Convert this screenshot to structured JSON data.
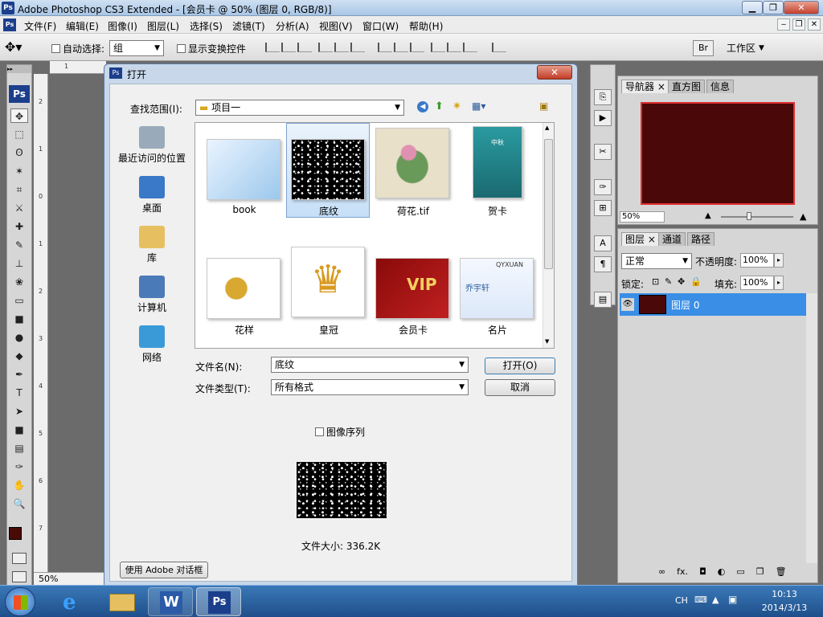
{
  "window": {
    "title": "Adobe Photoshop CS3 Extended - [会员卡 @ 50% (图层 0, RGB/8)]",
    "ps_label": "Ps"
  },
  "menu": [
    "文件(F)",
    "编辑(E)",
    "图像(I)",
    "图层(L)",
    "选择(S)",
    "滤镜(T)",
    "分析(A)",
    "视图(V)",
    "窗口(W)",
    "帮助(H)"
  ],
  "options": {
    "auto_select_label": "自动选择:",
    "auto_select_value": "组",
    "show_transform_label": "显示变换控件",
    "workspace_label": "工作区"
  },
  "toolbox": {
    "logo": "Ps",
    "tools": [
      "move-tool",
      "marquee-tool",
      "lasso-tool",
      "magic-wand-tool",
      "crop-tool",
      "slice-tool",
      "healing-brush-tool",
      "brush-tool",
      "clone-stamp-tool",
      "history-brush-tool",
      "eraser-tool",
      "gradient-tool",
      "blur-tool",
      "dodge-tool",
      "pen-tool",
      "type-tool",
      "path-selection-tool",
      "shape-tool",
      "notes-tool",
      "eyedropper-tool",
      "hand-tool",
      "zoom-tool"
    ],
    "tool_glyphs": [
      "✥",
      "⬚",
      "ʘ",
      "✶",
      "⌗",
      "⚔",
      "✚",
      "✎",
      "⊥",
      "❀",
      "▭",
      "■",
      "●",
      "◆",
      "✒",
      "T",
      "➤",
      "■",
      "▤",
      "✑",
      "✋",
      "🔍"
    ],
    "foreground_color": "#4a0a0a",
    "background_color": "#ffffff",
    "zoom": "50%"
  },
  "ruler": {
    "top_marks": [
      "1"
    ],
    "left_marks": [
      "2",
      "1",
      "0",
      "1",
      "2",
      "3",
      "4",
      "5",
      "6",
      "7"
    ]
  },
  "dialog": {
    "title": "打开",
    "look_in_label": "查找范围(I):",
    "look_in_value": "项目一",
    "places": [
      {
        "label": "最近访问的位置",
        "icon": "recent-places-icon"
      },
      {
        "label": "桌面",
        "icon": "desktop-icon"
      },
      {
        "label": "库",
        "icon": "libraries-icon"
      },
      {
        "label": "计算机",
        "icon": "computer-icon"
      },
      {
        "label": "网络",
        "icon": "network-icon"
      }
    ],
    "files": [
      {
        "name": "book",
        "selected": false,
        "thumb": "book"
      },
      {
        "name": "底纹",
        "selected": true,
        "thumb": "pattern"
      },
      {
        "name": "荷花.tif",
        "selected": false,
        "thumb": "lotus"
      },
      {
        "name": "贺卡",
        "selected": false,
        "thumb": "card"
      },
      {
        "name": "花样",
        "selected": false,
        "thumb": "floral"
      },
      {
        "name": "皇冠",
        "selected": false,
        "thumb": "crown"
      },
      {
        "name": "会员卡",
        "selected": false,
        "thumb": "vip"
      },
      {
        "name": "名片",
        "selected": false,
        "thumb": "namecard"
      }
    ],
    "thumb_text": {
      "vip": "VIP",
      "namecard_brand": "QYXUAN",
      "namecard_name": "乔宇轩",
      "card_title": "中秋"
    },
    "file_name_label": "文件名(N):",
    "file_name_value": "底纹",
    "file_type_label": "文件类型(T):",
    "file_type_value": "所有格式",
    "open_button": "打开(O)",
    "cancel_button": "取消",
    "image_sequence_label": "图像序列",
    "file_size": "文件大小: 336.2K",
    "adobe_dialog_button": "使用 Adobe 对话框"
  },
  "navigator": {
    "tabs": [
      "导航器",
      "直方图",
      "信息"
    ],
    "zoom": "50%",
    "preview_color": "#4a0808"
  },
  "layers": {
    "tabs": [
      "图层",
      "通道",
      "路径"
    ],
    "blend_mode": "正常",
    "opacity_label": "不透明度:",
    "opacity_value": "100%",
    "lock_label": "锁定:",
    "fill_label": "填充:",
    "fill_value": "100%",
    "layer_name": "图层 0",
    "layer_color": "#4a0808"
  },
  "taskbar": {
    "input_lang": "CH",
    "time": "10:13",
    "date": "2014/3/13"
  }
}
